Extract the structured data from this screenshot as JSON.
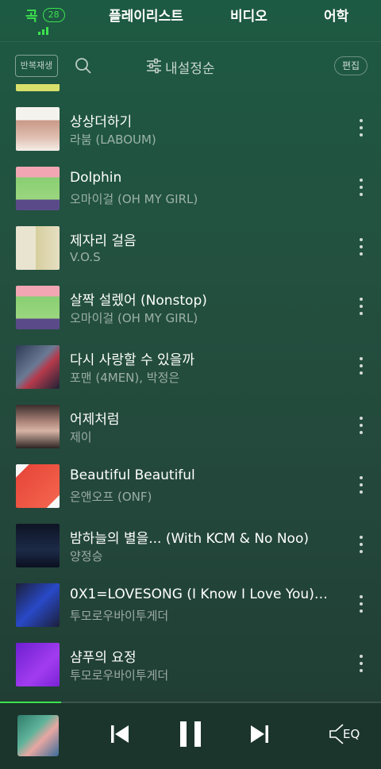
{
  "tabs": {
    "songs": "곡",
    "songs_count": "28",
    "playlist": "플레이리스트",
    "video": "비디오",
    "language": "어학"
  },
  "toolbar": {
    "repeat_label": "반복재생",
    "sort_label": "내설정순",
    "edit_label": "편집"
  },
  "songs": [
    {
      "title": "상상더하기",
      "artist": "라붐 (LABOUM)",
      "art": "laboum"
    },
    {
      "title": "Dolphin",
      "artist": "오마이걸 (OH MY GIRL)",
      "art": "ohmygirl"
    },
    {
      "title": "제자리 걸음",
      "artist": "V.O.S",
      "art": "vos"
    },
    {
      "title": "살짝 설렜어 (Nonstop)",
      "artist": "오마이걸 (OH MY GIRL)",
      "art": "ohmygirl"
    },
    {
      "title": "다시 사랑할 수 있을까",
      "artist": "포맨 (4MEN), 박정은",
      "art": "4men"
    },
    {
      "title": "어제처럼",
      "artist": "제이",
      "art": "jay"
    },
    {
      "title": "Beautiful Beautiful",
      "artist": "온앤오프 (ONF)",
      "art": "onf"
    },
    {
      "title": "밤하늘의 별을... (With KCM & No Noo)",
      "artist": "양정승",
      "art": "yang"
    },
    {
      "title": "0X1=LOVESONG (I Know I Love You) f...",
      "artist": "투모로우바이투게더",
      "art": "txt1"
    },
    {
      "title": "샴푸의 요정",
      "artist": "투모로우바이투게더",
      "art": "txt2"
    }
  ],
  "player": {
    "progress_percent": 16,
    "eq_label": "EQ"
  },
  "colors": {
    "accent": "#3ce24e",
    "background": "#23503f"
  }
}
